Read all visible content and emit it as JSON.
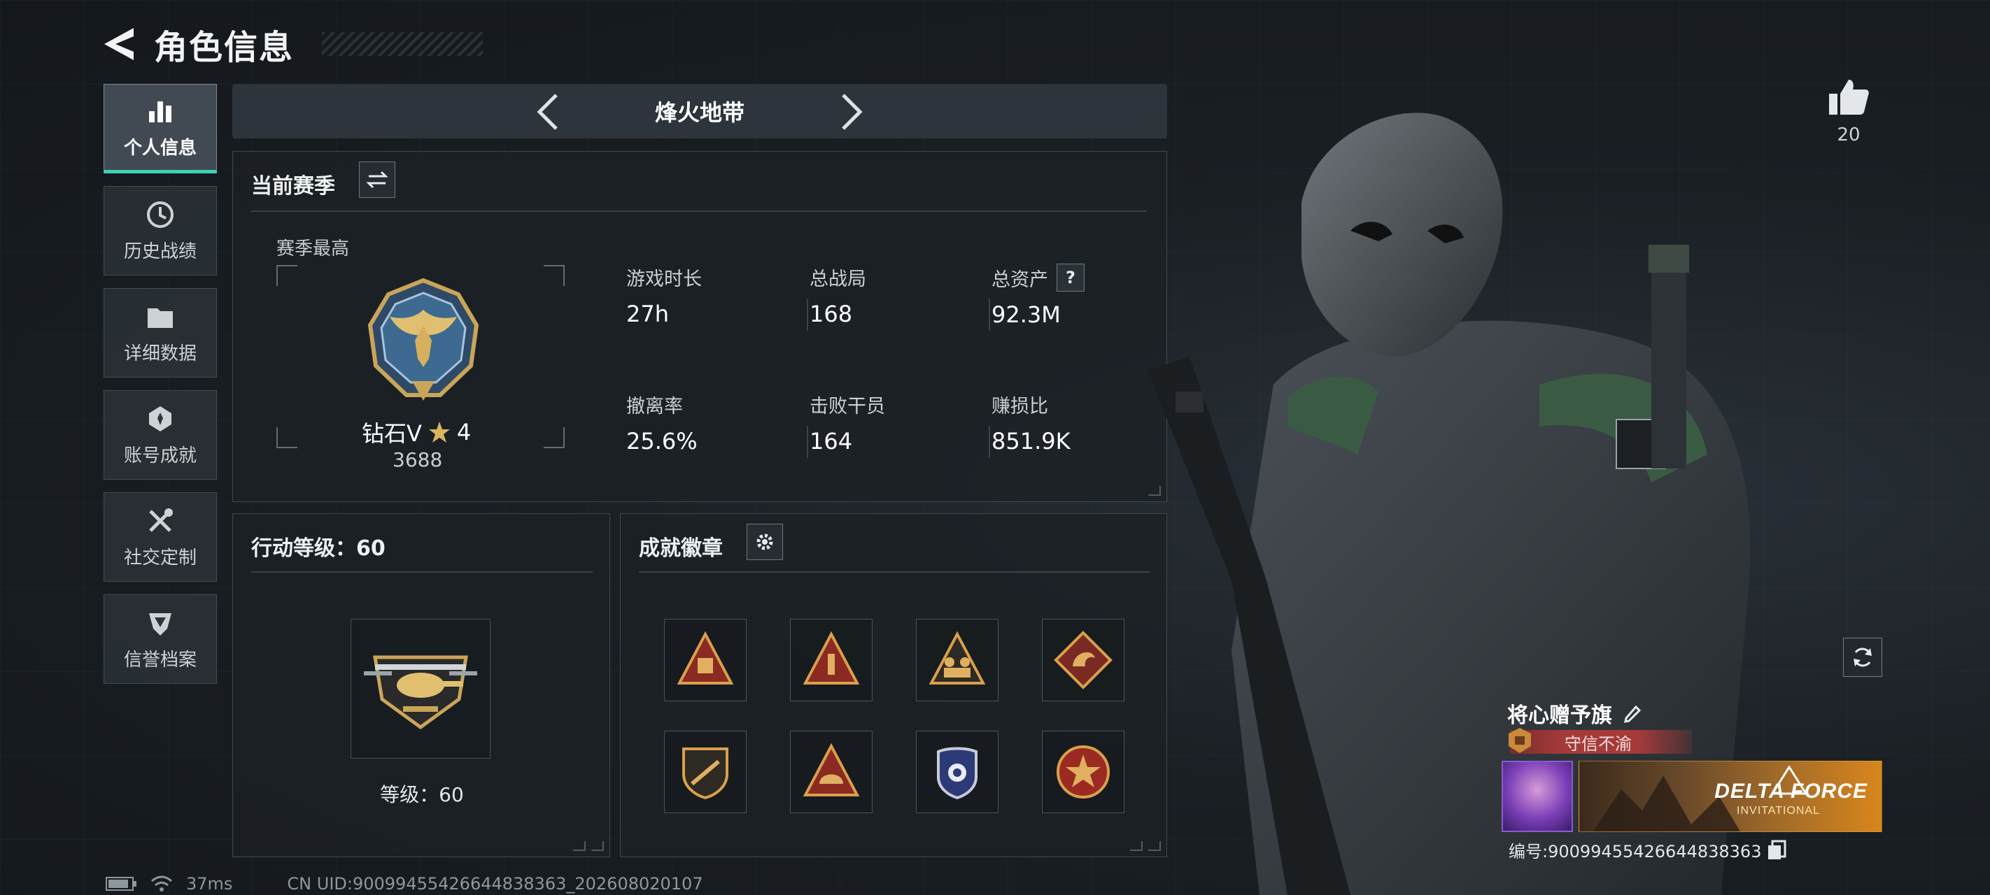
{
  "header": {
    "title": "角色信息"
  },
  "sidebar": {
    "items": [
      {
        "label": "个人信息",
        "icon": "bar-chart-icon",
        "active": true
      },
      {
        "label": "历史战绩",
        "icon": "history-icon",
        "active": false
      },
      {
        "label": "详细数据",
        "icon": "folder-icon",
        "active": false
      },
      {
        "label": "账号成就",
        "icon": "achievement-icon",
        "active": false
      },
      {
        "label": "社交定制",
        "icon": "tools-icon",
        "active": false
      },
      {
        "label": "信誉档案",
        "icon": "reputation-icon",
        "active": false
      }
    ]
  },
  "mode": {
    "title": "烽火地带"
  },
  "season": {
    "title": "当前赛季",
    "peak_label": "赛季最高",
    "rank_name": "钻石V",
    "rank_stars": "4",
    "rank_score": "3688",
    "stats": [
      {
        "label": "游戏时长",
        "value": "27h"
      },
      {
        "label": "总战局",
        "value": "168"
      },
      {
        "label": "总资产",
        "value": "92.3M",
        "help": "?"
      },
      {
        "label": "撤离率",
        "value": "25.6%"
      },
      {
        "label": "击败干员",
        "value": "164"
      },
      {
        "label": "赚损比",
        "value": "851.9K"
      }
    ]
  },
  "level": {
    "title": "行动等级：60",
    "text": "等级：60"
  },
  "badges": {
    "title": "成就徽章",
    "items": [
      "badge-1",
      "badge-2",
      "badge-3",
      "badge-4",
      "badge-5",
      "badge-6",
      "badge-7",
      "badge-8"
    ]
  },
  "status": {
    "ping": "37ms",
    "uid": "CN UID:9009945542664483836​3_202608020107"
  },
  "profile": {
    "likes": "20",
    "card_name": "将心赠予旗",
    "honor": "守信不渝",
    "banner_title": "DELTA FORCE",
    "banner_sub": "INVITATIONAL",
    "card_id": "编号:9009945542664483836​3"
  },
  "colors": {
    "accent": "#3fd0b8",
    "honor": "#a63a3a",
    "banner": "#d8861c"
  }
}
